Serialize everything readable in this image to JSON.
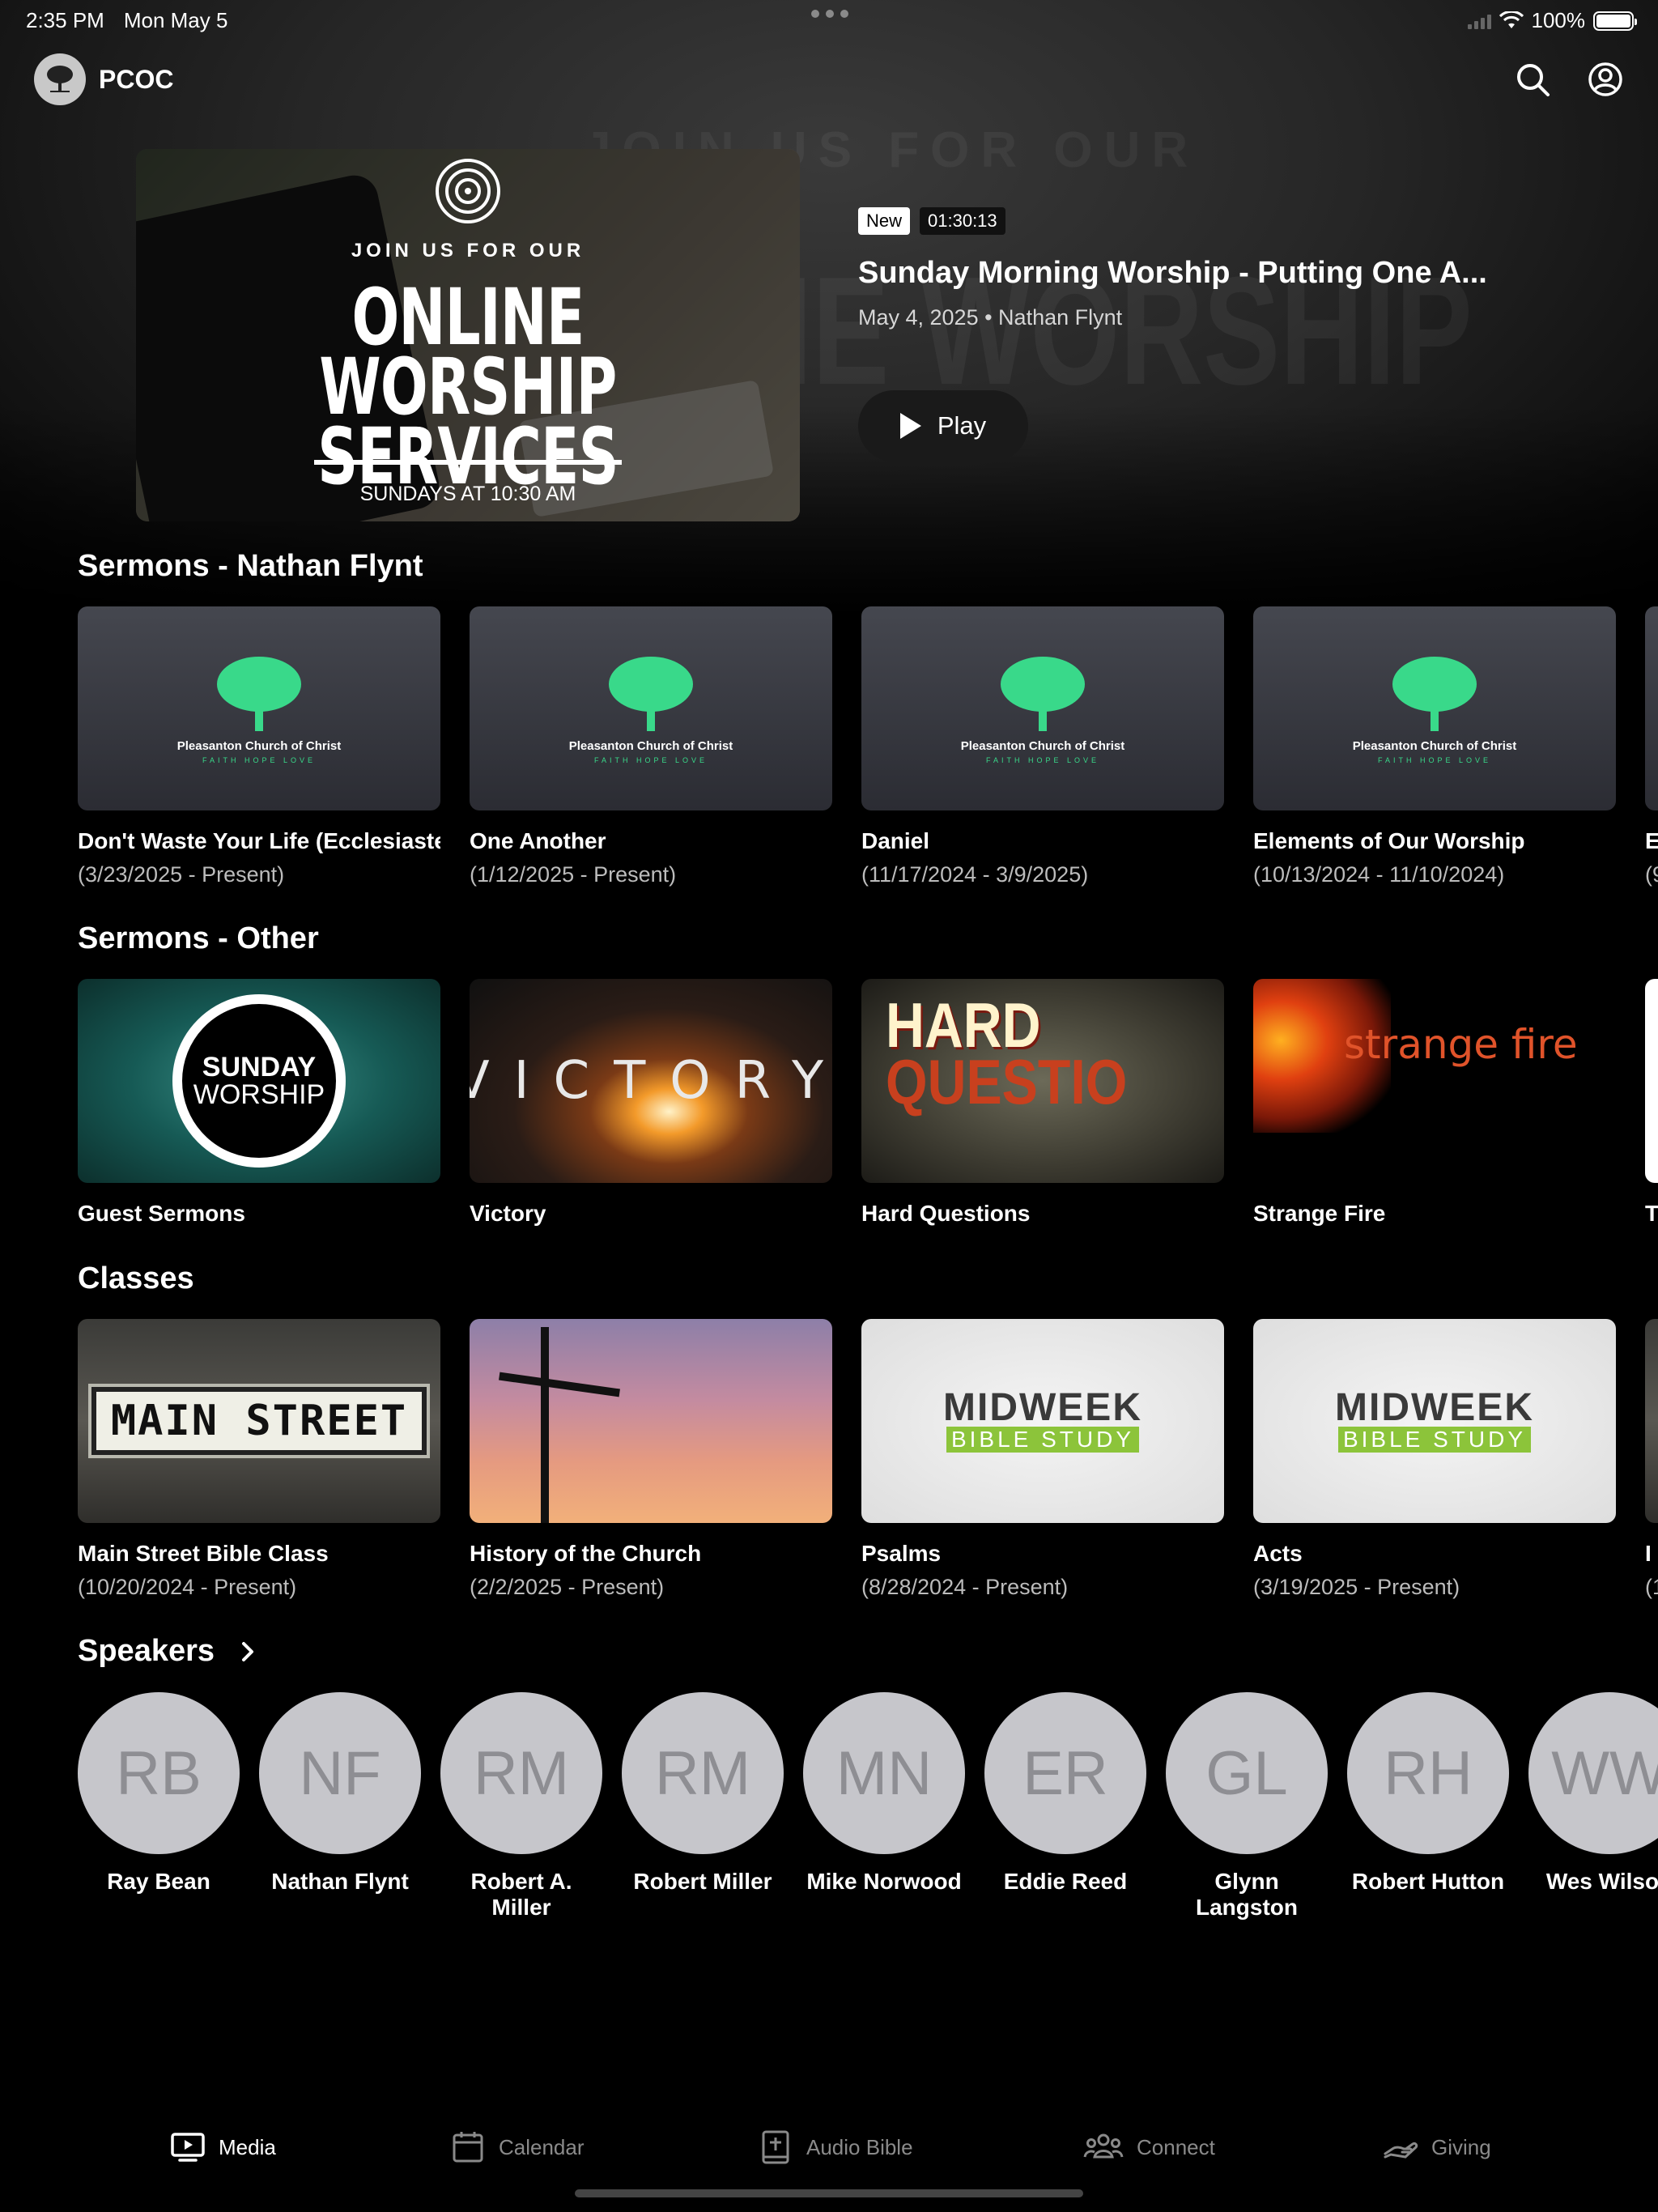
{
  "status_bar": {
    "time": "2:35 PM",
    "date": "Mon May 5",
    "battery": "100%"
  },
  "header": {
    "app_name": "PCOC"
  },
  "featured": {
    "thumb": {
      "join": "JOIN US FOR OUR",
      "title_line1": "ONLINE WORSHIP",
      "title_line2": "SERVICES",
      "subtitle": "SUNDAYS AT 10:30 AM"
    },
    "badge": "New",
    "duration": "01:30:13",
    "title": "Sunday Morning Worship - Putting One A...",
    "meta": "May 4, 2025 • Nathan Flynt",
    "play_label": "Play"
  },
  "pcoc_card": {
    "name": "Pleasanton Church of Christ",
    "tagline": "FAITH HOPE LOVE"
  },
  "sermons_nathan": {
    "title": "Sermons - Nathan Flynt",
    "items": [
      {
        "title": "Don't Waste Your Life (Ecclesiastes)",
        "dates": "(3/23/2025 - Present)"
      },
      {
        "title": "One Another",
        "dates": "(1/12/2025 - Present)"
      },
      {
        "title": "Daniel",
        "dates": "(11/17/2024 - 3/9/2025)"
      },
      {
        "title": "Elements of Our Worship",
        "dates": "(10/13/2024 - 11/10/2024)"
      },
      {
        "title": "E",
        "dates": "(9"
      }
    ]
  },
  "sermons_other": {
    "title": "Sermons - Other",
    "thumbs": {
      "sunday_l1": "SUNDAY",
      "sunday_l2": "WORSHIP",
      "victory": "VICTORY",
      "hard_l1": "HARD",
      "hard_l2": "QUESTIO",
      "strange": "strange fire"
    },
    "items": [
      {
        "title": "Guest Sermons"
      },
      {
        "title": "Victory"
      },
      {
        "title": "Hard Questions"
      },
      {
        "title": "Strange Fire"
      },
      {
        "title": "T"
      }
    ]
  },
  "classes": {
    "title": "Classes",
    "thumbs": {
      "main_street": "MAIN STREET",
      "midweek": "MIDWEEK",
      "bible_study": "BIBLE STUDY"
    },
    "items": [
      {
        "title": "Main Street Bible Class",
        "dates": "(10/20/2024 - Present)"
      },
      {
        "title": "History of the Church",
        "dates": "(2/2/2025 - Present)"
      },
      {
        "title": "Psalms",
        "dates": "(8/28/2024 - Present)"
      },
      {
        "title": "Acts",
        "dates": "(3/19/2025 - Present)"
      },
      {
        "title": "I",
        "dates": "(1"
      }
    ]
  },
  "speakers": {
    "title": "Speakers",
    "items": [
      {
        "initials": "RB",
        "name": "Ray Bean"
      },
      {
        "initials": "NF",
        "name": "Nathan Flynt"
      },
      {
        "initials": "RM",
        "name": "Robert A. Miller"
      },
      {
        "initials": "RM",
        "name": "Robert Miller"
      },
      {
        "initials": "MN",
        "name": "Mike Norwood"
      },
      {
        "initials": "ER",
        "name": "Eddie Reed"
      },
      {
        "initials": "GL",
        "name": "Glynn Langston"
      },
      {
        "initials": "RH",
        "name": "Robert Hutton"
      },
      {
        "initials": "WW",
        "name": "Wes Wilson"
      }
    ]
  },
  "tabs": [
    {
      "label": "Media",
      "icon": "tv-icon",
      "active": true
    },
    {
      "label": "Calendar",
      "icon": "calendar-icon",
      "active": false
    },
    {
      "label": "Audio Bible",
      "icon": "bible-icon",
      "active": false
    },
    {
      "label": "Connect",
      "icon": "people-icon",
      "active": false
    },
    {
      "label": "Giving",
      "icon": "giving-hand-icon",
      "active": false
    }
  ]
}
